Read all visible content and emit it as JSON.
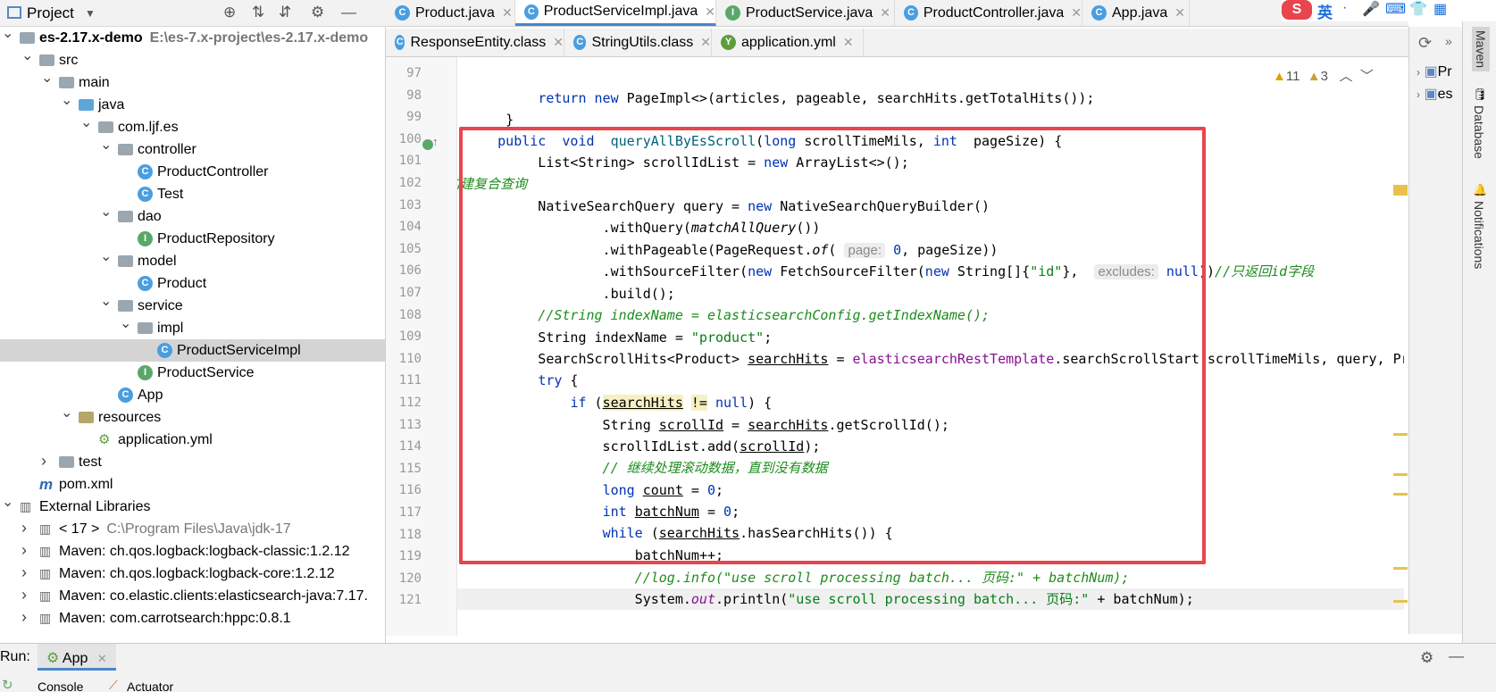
{
  "project_pane": {
    "title": "Project",
    "tree": [
      {
        "label": "es-2.17.x-demo",
        "path": "E:\\es-7.x-project\\es-2.17.x-demo",
        "icon": "module-folder-icon",
        "bold": true
      },
      {
        "label": "src",
        "icon": "folder-icon"
      },
      {
        "label": "main",
        "icon": "folder-icon"
      },
      {
        "label": "java",
        "icon": "source-folder-icon"
      },
      {
        "label": "com.ljf.es",
        "icon": "package-icon"
      },
      {
        "label": "controller",
        "icon": "package-icon"
      },
      {
        "label": "ProductController",
        "icon": "class-icon"
      },
      {
        "label": "Test",
        "icon": "class-icon"
      },
      {
        "label": "dao",
        "icon": "package-icon"
      },
      {
        "label": "ProductRepository",
        "icon": "interface-icon"
      },
      {
        "label": "model",
        "icon": "package-icon"
      },
      {
        "label": "Product",
        "icon": "class-icon"
      },
      {
        "label": "service",
        "icon": "package-icon"
      },
      {
        "label": "impl",
        "icon": "package-icon"
      },
      {
        "label": "ProductServiceImpl",
        "icon": "class-icon"
      },
      {
        "label": "ProductService",
        "icon": "interface-icon"
      },
      {
        "label": "App",
        "icon": "spring-class-icon"
      },
      {
        "label": "resources",
        "icon": "resources-folder-icon"
      },
      {
        "label": "application.yml",
        "icon": "yml-icon"
      },
      {
        "label": "test",
        "icon": "folder-icon"
      },
      {
        "label": "pom.xml",
        "icon": "maven-icon"
      },
      {
        "label": "External Libraries",
        "icon": "library-icon"
      },
      {
        "label": "< 17 >",
        "path": "C:\\Program Files\\Java\\jdk-17",
        "icon": "jdk-icon"
      },
      {
        "label": "Maven: ch.qos.logback:logback-classic:1.2.12",
        "icon": "library-icon"
      },
      {
        "label": "Maven: ch.qos.logback:logback-core:1.2.12",
        "icon": "library-icon"
      },
      {
        "label": "Maven: co.elastic.clients:elasticsearch-java:7.17.",
        "icon": "library-icon"
      },
      {
        "label": "Maven: com.carrotsearch:hppc:0.8.1",
        "icon": "library-icon"
      }
    ]
  },
  "tabs_row1": [
    {
      "label": "Product.java",
      "icon": "C",
      "color": "#4a9ee0"
    },
    {
      "label": "ProductServiceImpl.java",
      "icon": "C",
      "color": "#4a9ee0",
      "active": true
    },
    {
      "label": "ProductService.java",
      "icon": "I",
      "color": "#59a869"
    },
    {
      "label": "ProductController.java",
      "icon": "C",
      "color": "#4a9ee0"
    },
    {
      "label": "App.java",
      "icon": "C",
      "color": "#4a9ee0"
    }
  ],
  "tabs_row2": [
    {
      "label": "ResponseEntity.class",
      "icon": "C",
      "color": "#4a9ee0"
    },
    {
      "label": "StringUtils.class",
      "icon": "C",
      "color": "#4a9ee0"
    },
    {
      "label": "application.yml",
      "icon": "Y",
      "color": "#5c9e3a"
    }
  ],
  "editor": {
    "warnings": "11",
    "weak_warnings": "3",
    "line_numbers": [
      "97",
      "98",
      "99",
      "100",
      "101",
      "102",
      "103",
      "104",
      "105",
      "106",
      "107",
      "108",
      "109",
      "110",
      "111",
      "112",
      "113",
      "114",
      "115",
      "116",
      "117",
      "118",
      "119",
      "120",
      "121"
    ]
  },
  "right_panel": {
    "items": [
      "Pr",
      "es"
    ],
    "side_tabs": [
      "Maven",
      "Database",
      "Notifications"
    ]
  },
  "run_bar": {
    "label": "Run:",
    "config": "App",
    "tabs": [
      "Console",
      "Actuator"
    ]
  },
  "colors": {
    "highlight_box": "#e8454c",
    "keyword": "#0033b3",
    "string": "#067d17",
    "comment": "#1e8c1e"
  }
}
